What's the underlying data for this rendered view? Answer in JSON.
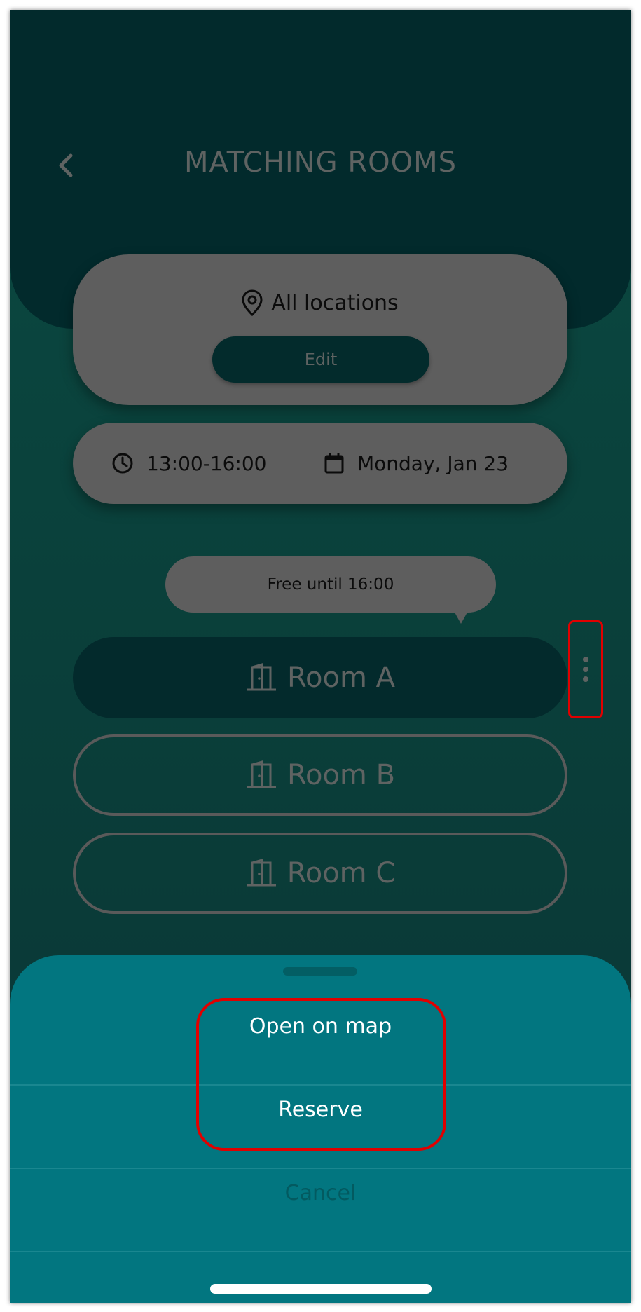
{
  "header": {
    "title": "MATCHING ROOMS"
  },
  "location": {
    "label": "All locations",
    "edit_label": "Edit"
  },
  "schedule": {
    "time": "13:00-16:00",
    "date": "Monday, Jan 23"
  },
  "availability": {
    "bubble_text": "Free until 16:00"
  },
  "rooms": [
    {
      "label": "Room A",
      "selected": true
    },
    {
      "label": "Room B",
      "selected": false
    },
    {
      "label": "Room C",
      "selected": false
    }
  ],
  "action_sheet": {
    "items": [
      {
        "label": "Open on map"
      },
      {
        "label": "Reserve"
      },
      {
        "label": "Cancel"
      }
    ]
  },
  "icons": {
    "back": "chevron-left-icon",
    "location": "map-pin-icon",
    "time": "clock-icon",
    "date": "calendar-icon",
    "room": "door-icon",
    "more": "more-vertical-icon"
  },
  "colors": {
    "header_dark": "#022a2c",
    "background": "#0a3f3a",
    "card_gray": "#5e5e5e",
    "sheet_teal": "#027680",
    "highlight_red": "#e00000"
  }
}
